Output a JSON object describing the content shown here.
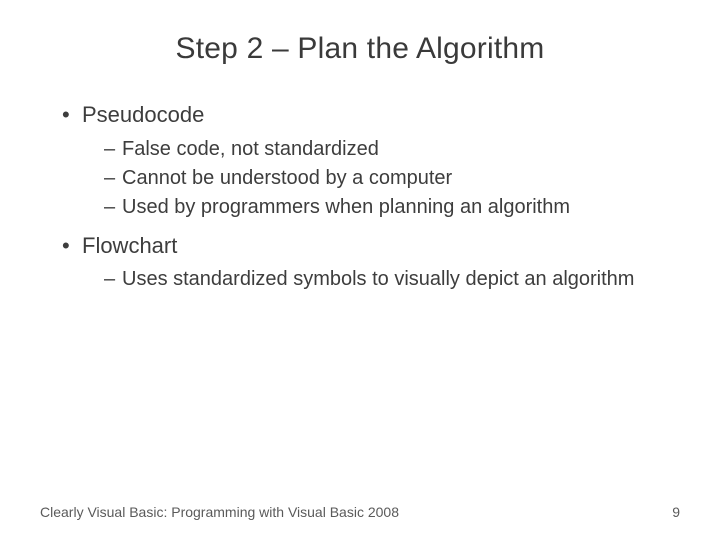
{
  "title": "Step 2 – Plan the Algorithm",
  "bullets": [
    {
      "label": "Pseudocode",
      "sub": [
        "False code, not standardized",
        "Cannot be understood by a computer",
        "Used by programmers when planning an algorithm"
      ]
    },
    {
      "label": "Flowchart",
      "sub": [
        "Uses standardized symbols to visually depict an algorithm"
      ]
    }
  ],
  "footer": {
    "source": "Clearly Visual Basic: Programming with Visual Basic 2008",
    "page": "9"
  }
}
